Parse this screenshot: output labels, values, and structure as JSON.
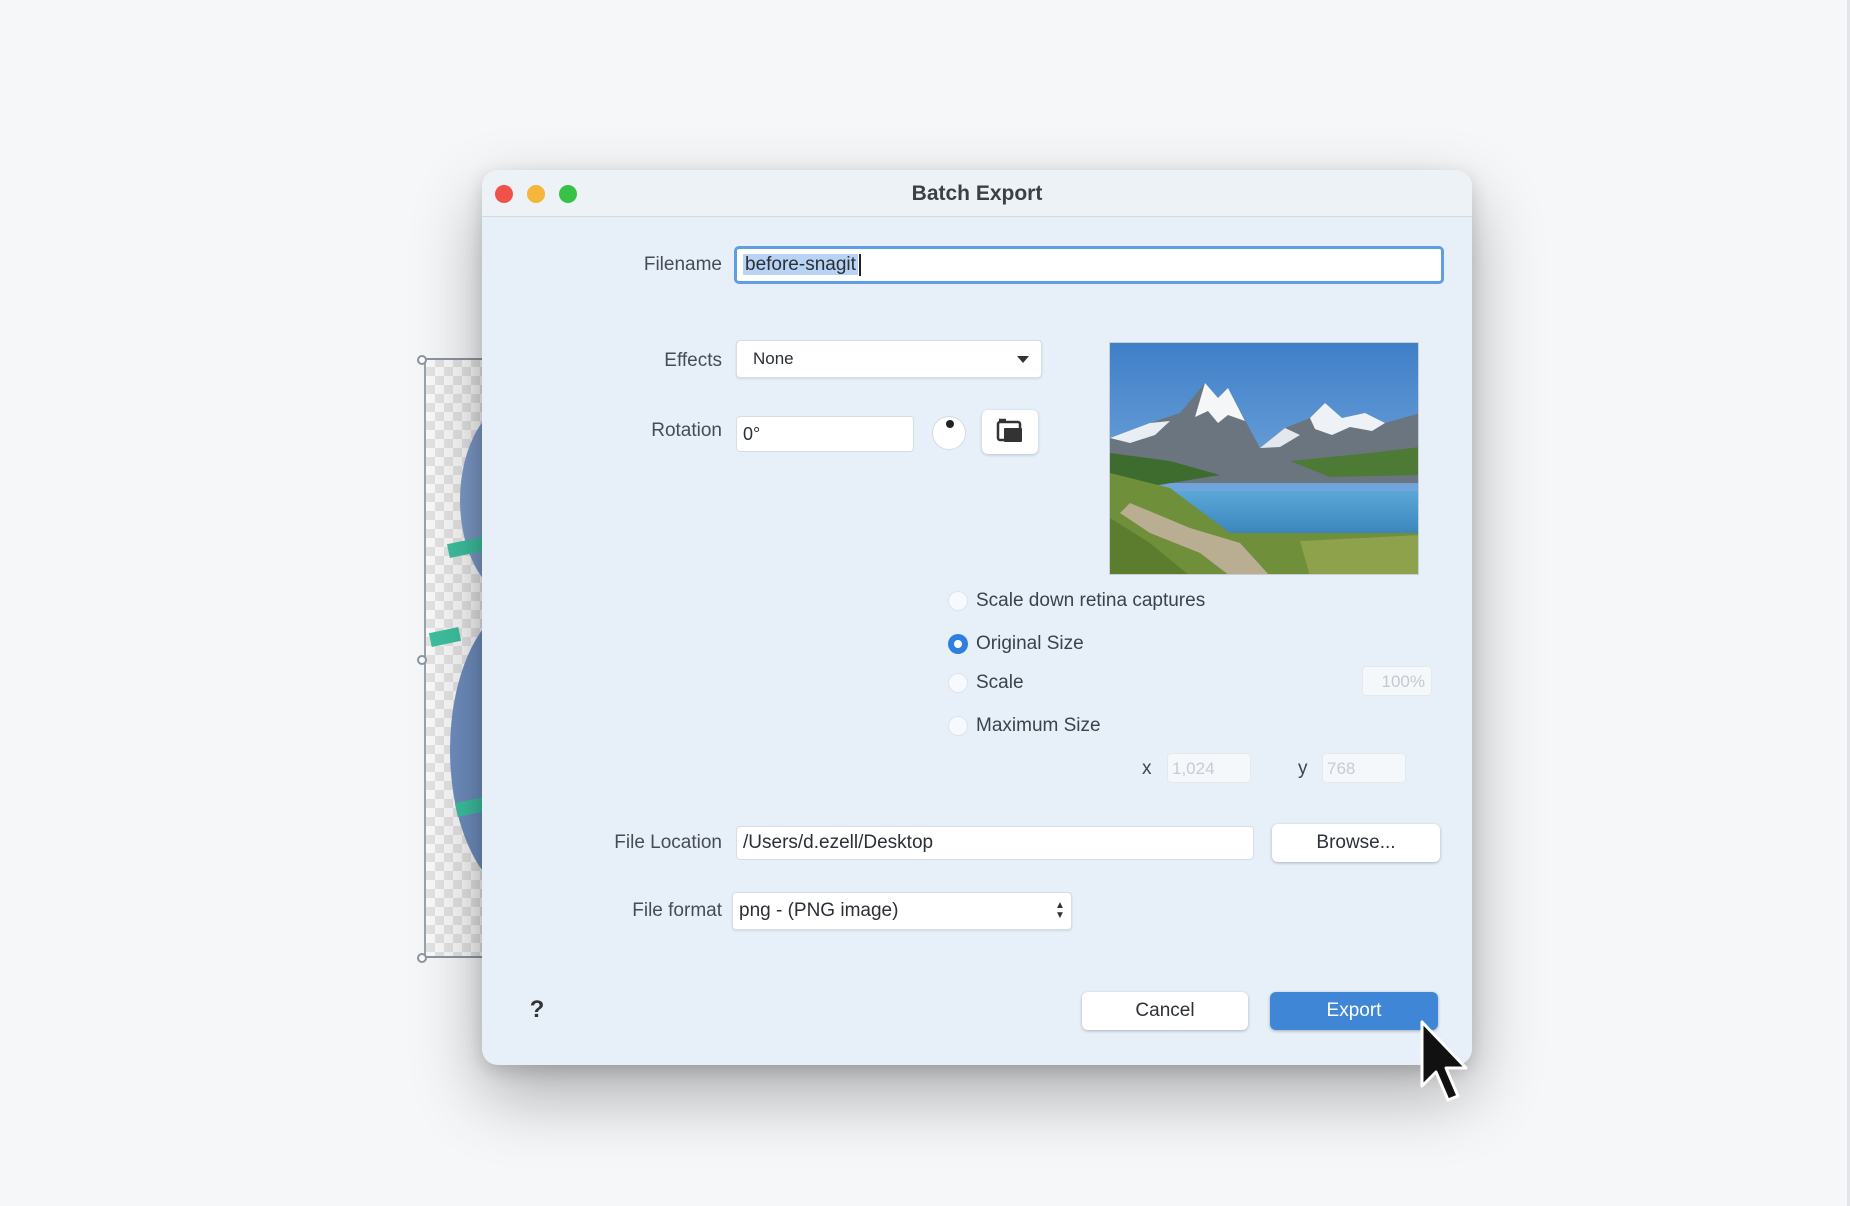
{
  "dialog": {
    "title": "Batch Export",
    "filename": {
      "label": "Filename",
      "value": "before-snagit"
    },
    "effects": {
      "label": "Effects",
      "value": "None"
    },
    "rotation": {
      "label": "Rotation",
      "value": "0°"
    },
    "size_options": {
      "retina_label": "Scale down retina captures",
      "original_label": "Original Size",
      "scale_label": "Scale",
      "scale_value": "100%",
      "max_label": "Maximum Size",
      "x_label": "x",
      "x_value": "1,024",
      "y_label": "y",
      "y_value": "768",
      "selected": "Original Size"
    },
    "location": {
      "label": "File Location",
      "value": "/Users/d.ezell/Desktop",
      "browse_label": "Browse..."
    },
    "format": {
      "label": "File format",
      "value": "png - (PNG image)"
    },
    "help_label": "?",
    "cancel_label": "Cancel",
    "export_label": "Export"
  },
  "colors": {
    "accent": "#3f87d6",
    "dialog_bg": "#e7f0f9",
    "close": "#f0524a",
    "minimize": "#f6b53b",
    "maximize": "#37c146"
  },
  "icons": [
    "close-icon",
    "minimize-icon",
    "maximize-icon",
    "rotation-dial-icon",
    "rotate-image-icon",
    "caret-down-icon",
    "stepper-arrows-icon",
    "help-icon",
    "mouse-pointer-icon"
  ]
}
